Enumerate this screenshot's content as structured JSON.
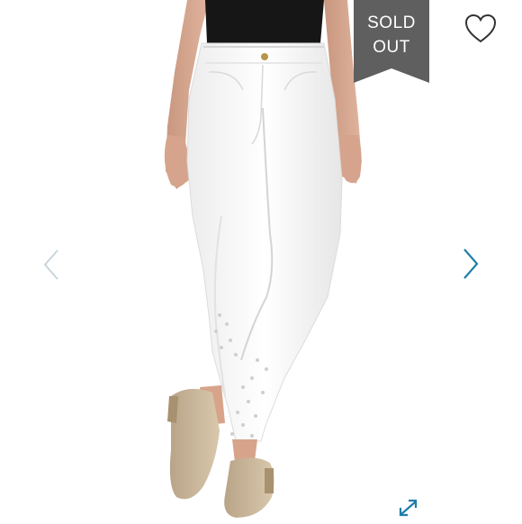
{
  "badge": {
    "line1": "SOLD",
    "line2": "OUT",
    "color": "#5f5f5f"
  },
  "icons": {
    "favorite": "heart-outline-icon",
    "previous": "chevron-left-icon",
    "next": "chevron-right-icon",
    "fullscreen": "expand-arrows-icon"
  },
  "colors": {
    "nav_next": "#1f7fa8",
    "nav_prev": "#c9d5db",
    "expand": "#1f7fa8",
    "heart": "#333333"
  }
}
